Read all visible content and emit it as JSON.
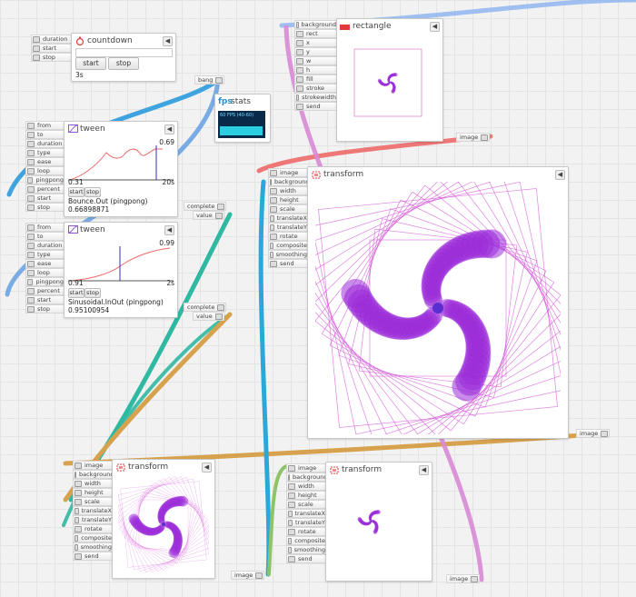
{
  "countdown": {
    "title": "countdown",
    "inputs": [
      "duration",
      "start",
      "stop"
    ],
    "start_label": "start",
    "stop_label": "stop",
    "time": "3s",
    "output": "bang"
  },
  "fps": {
    "title": "stats",
    "prefix": "fps",
    "reading": "60 FPS (40-60)"
  },
  "tween1": {
    "title": "tween",
    "inputs": [
      "from",
      "to",
      "duration",
      "type",
      "ease",
      "loop",
      "pingpong",
      "percent",
      "start",
      "stop"
    ],
    "value_top": "0.69",
    "value_left": "0.31",
    "duration": "20s",
    "start_label": "start",
    "stop_label": "stop",
    "easing": "Bounce.Out (pingpong)",
    "value": "0.66898871",
    "outputs": [
      "complete",
      "value"
    ]
  },
  "tween2": {
    "title": "tween",
    "inputs": [
      "from",
      "to",
      "duration",
      "type",
      "ease",
      "loop",
      "pingpong",
      "percent",
      "start",
      "stop"
    ],
    "value_top": "0.99",
    "value_left": "0.91",
    "duration": "2s",
    "start_label": "start",
    "stop_label": "stop",
    "easing": "Sinusoidal.InOut (pingpong)",
    "value": "0.95100954",
    "outputs": [
      "complete",
      "value"
    ]
  },
  "rectangle": {
    "title": "rectangle",
    "inputs": [
      "background",
      "rect",
      "x",
      "y",
      "w",
      "h",
      "fill",
      "stroke",
      "strokewidth",
      "send"
    ],
    "output": "image",
    "accent": "#e03a3a"
  },
  "transform_big": {
    "title": "transform",
    "inputs": [
      "image",
      "background",
      "width",
      "height",
      "scale",
      "translateX",
      "translateY",
      "rotate",
      "composite",
      "smoothing",
      "send"
    ],
    "output": "image"
  },
  "transform_bl": {
    "title": "transform",
    "inputs": [
      "image",
      "background",
      "width",
      "height",
      "scale",
      "translateX",
      "translateY",
      "rotate",
      "composite",
      "smoothing",
      "send"
    ],
    "output": "image"
  },
  "transform_br": {
    "title": "transform",
    "inputs": [
      "image",
      "background",
      "width",
      "height",
      "scale",
      "translateX",
      "translateY",
      "rotate",
      "composite",
      "smoothing",
      "send"
    ],
    "output": "image"
  },
  "close_glyph": "◀",
  "colors": {
    "wire_blue": "#3fa3e0",
    "wire_teal": "#2fb8a2",
    "wire_orange": "#d7a24e",
    "wire_pink": "#d98ad6",
    "wire_red": "#ee7878",
    "wire_lightblue": "#8fb6f0",
    "wire_green": "#8dc46a",
    "art_purple": "#9a2bd8"
  }
}
